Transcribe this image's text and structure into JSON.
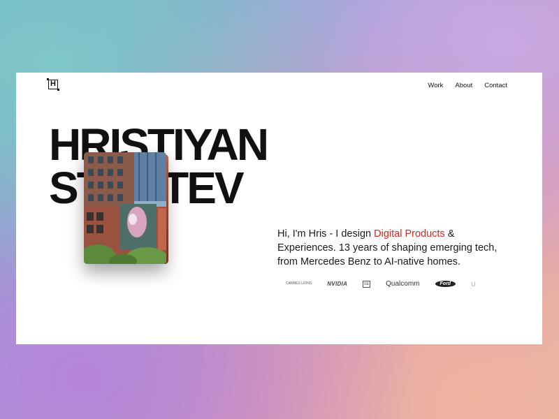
{
  "header": {
    "logo_text": "H",
    "nav": [
      {
        "label": "Work"
      },
      {
        "label": "About"
      },
      {
        "label": "Contact"
      }
    ]
  },
  "hero": {
    "name_line1": "HRISTIYAN",
    "name_line2": "STOYTEV",
    "photo_alt": "city building with mural",
    "intro_before": "Hi, I'm Hris - I design ",
    "intro_accent": "Digital Products",
    "intro_after": " & Experiences. 13 years of shaping emerging tech, from Mercedes Benz to AI-native homes.",
    "accent_color": "#d8261c"
  },
  "clients": [
    {
      "label": "CANNES LIONS",
      "icon": "cannes-lions-logo"
    },
    {
      "label": "NVIDIA",
      "icon": "nvidia-logo"
    },
    {
      "label": "GE",
      "icon": "ge-logo"
    },
    {
      "label": "Qualcomm",
      "icon": "qualcomm-logo"
    },
    {
      "label": "Ford",
      "icon": "ford-logo"
    },
    {
      "label": "U",
      "icon": "partial-logo"
    }
  ]
}
